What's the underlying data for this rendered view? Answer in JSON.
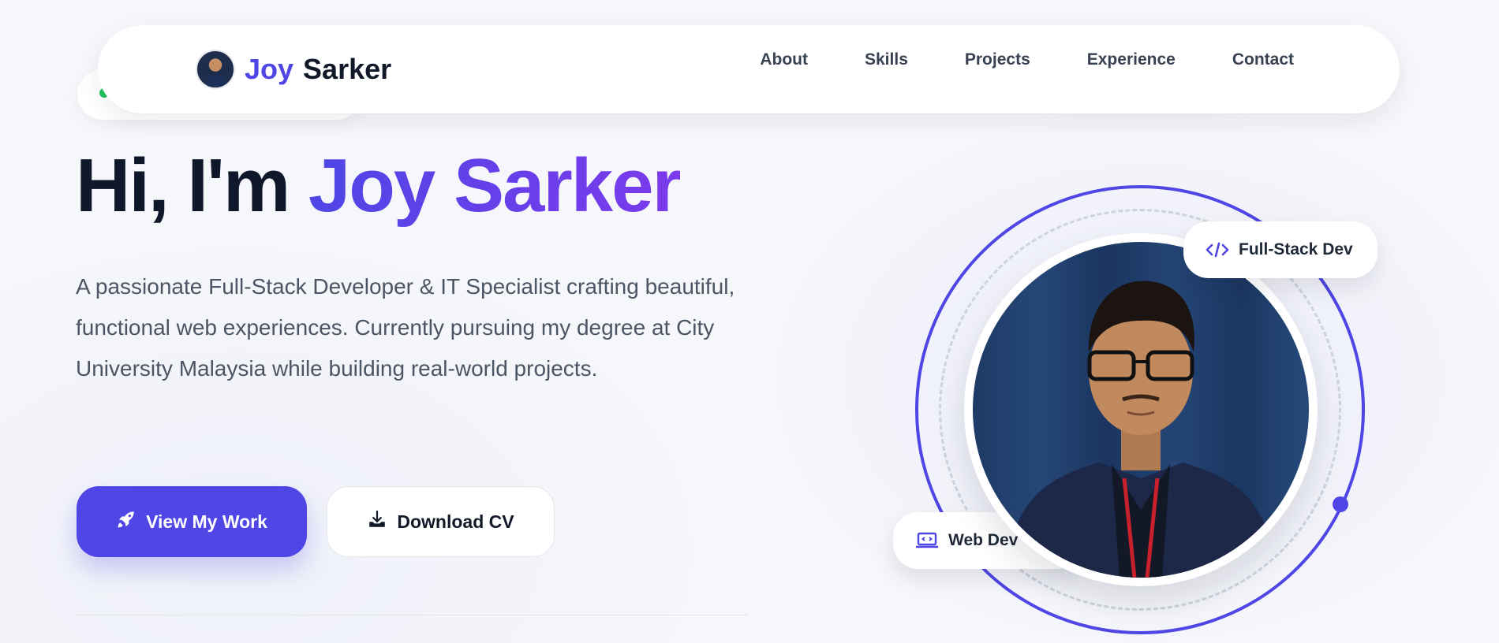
{
  "nav": {
    "brand_first": "Joy",
    "brand_last": "Sarker",
    "links": [
      "About",
      "Skills",
      "Projects",
      "Experience",
      "Contact"
    ]
  },
  "hero": {
    "greeting": "Hi, I'm",
    "name": "Joy Sarker",
    "description": "A passionate Full-Stack Developer & IT Specialist crafting beautiful, functional web experiences. Currently pursuing my degree at City University Malaysia while building real-world projects.",
    "primary_button": "View My Work",
    "secondary_button": "Download CV"
  },
  "badges": {
    "top": "Full-Stack Dev",
    "bottom": "Web Dev"
  },
  "icons": {
    "primary_button": "rocket-icon",
    "secondary_button": "download-icon",
    "badge_top": "code-icon",
    "badge_bottom": "laptop-code-icon"
  },
  "colors": {
    "accent": "#4f46e5",
    "accent_gradient_end": "#7c3aed",
    "heading": "#0f172a",
    "body_text": "#4b5563",
    "status_dot": "#22c55e"
  }
}
